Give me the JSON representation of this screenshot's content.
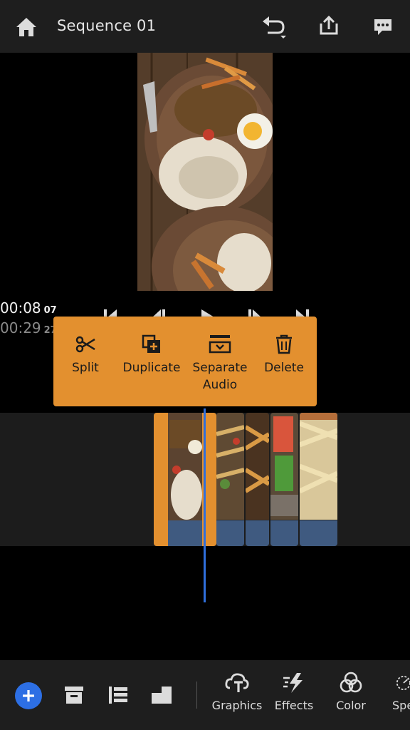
{
  "header": {
    "title": "Sequence 01",
    "icons": [
      "home-icon",
      "undo-icon",
      "export-icon",
      "feedback-icon"
    ]
  },
  "playback": {
    "current_time": "00:08",
    "current_frame": "07",
    "total_time": "00:29",
    "total_frame": "27"
  },
  "context_menu": {
    "split": "Split",
    "duplicate": "Duplicate",
    "separate_line1": "Separate",
    "separate_line2": "Audio",
    "delete": "Delete"
  },
  "toolbar": {
    "graphics": "Graphics",
    "effects": "Effects",
    "color": "Color",
    "speed": "Spe"
  },
  "colors": {
    "accent": "#e3902f",
    "playhead": "#2f6fdc",
    "add_button": "#2d6fe4",
    "waveform": "#3f5a80"
  }
}
